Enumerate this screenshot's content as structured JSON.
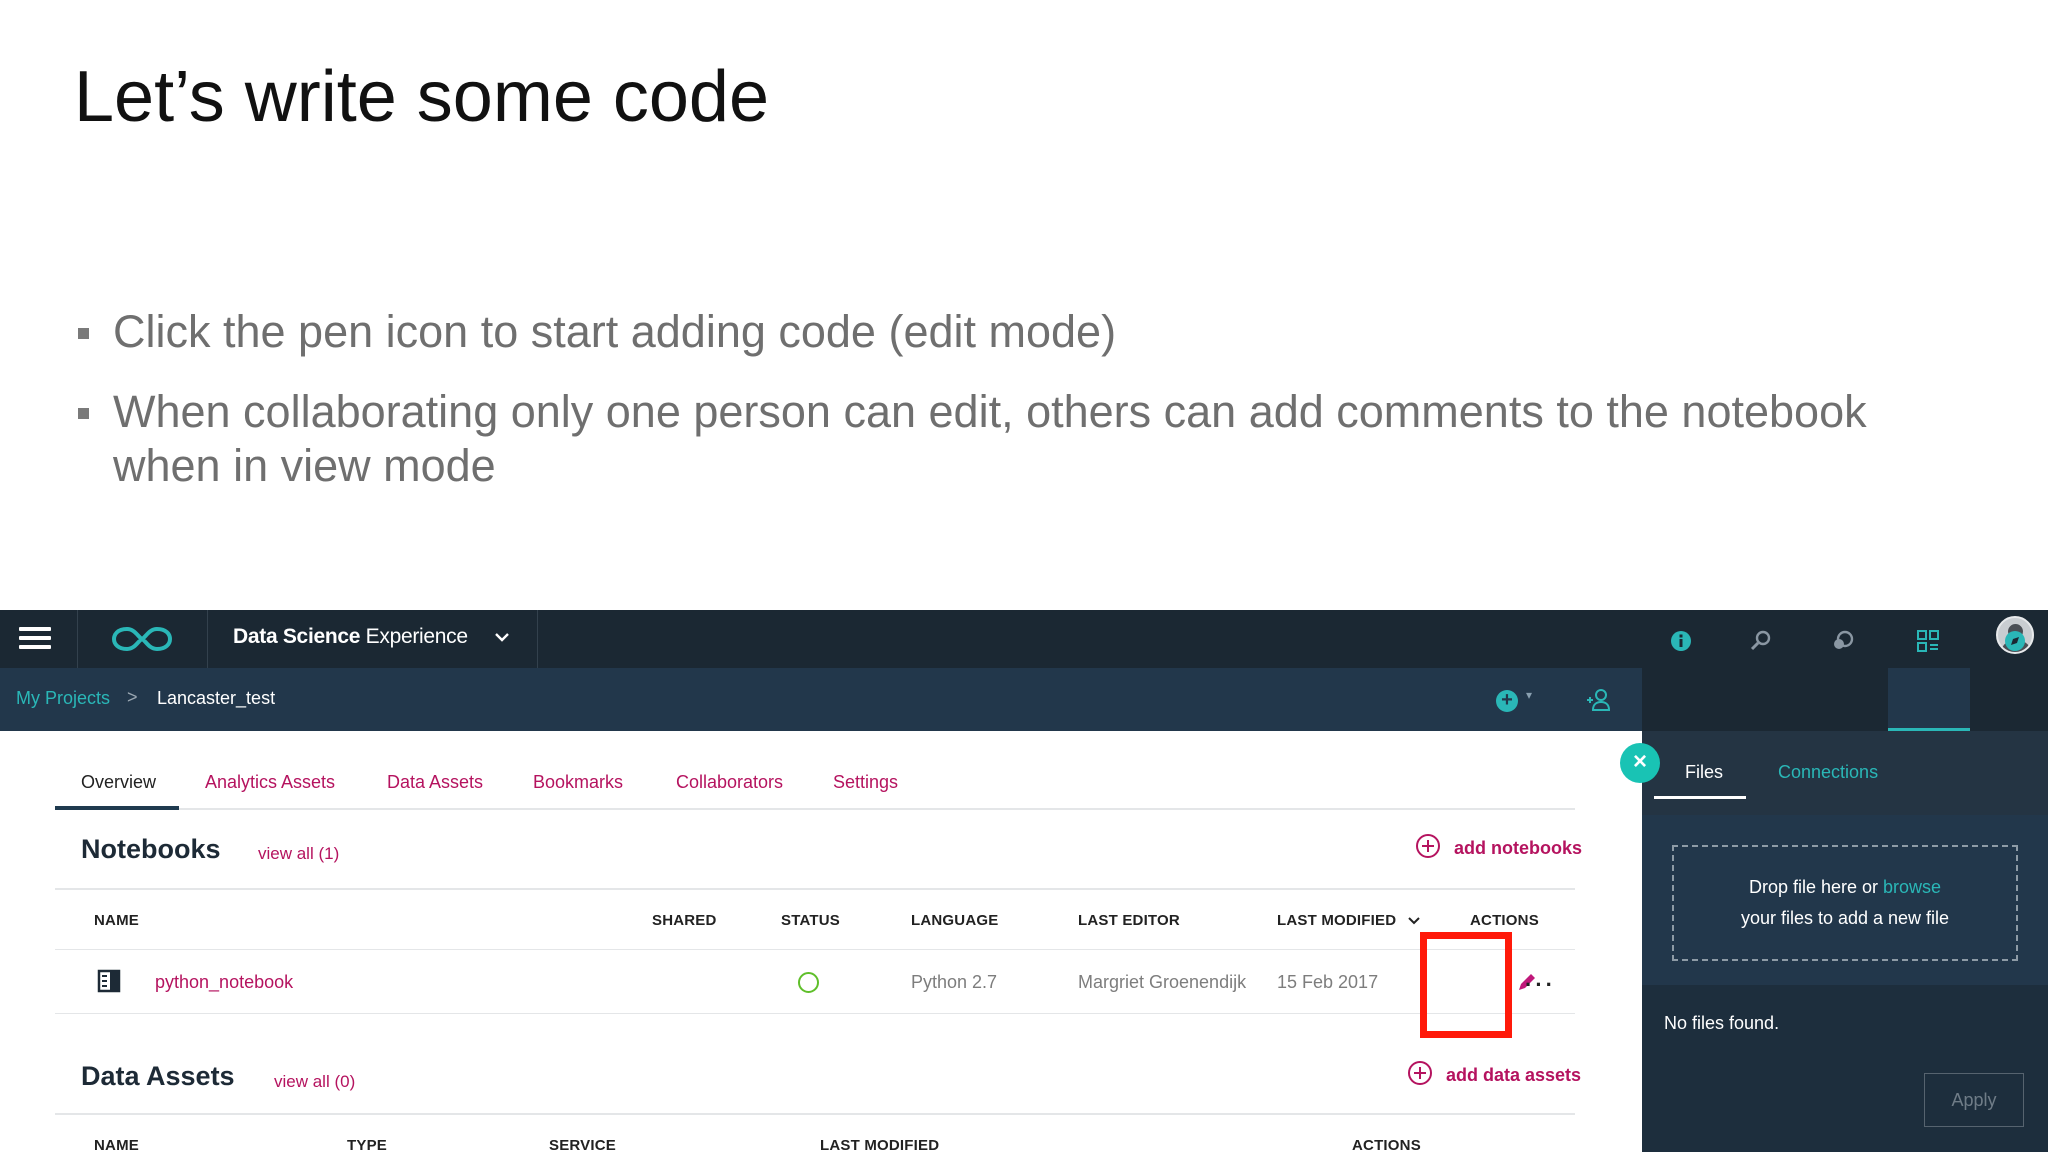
{
  "slide": {
    "title": "Let’s write some code",
    "bullets": [
      "Click the pen icon to start adding code (edit mode)",
      "When collaborating only one person can edit, others can add comments to the notebook when in view mode"
    ]
  },
  "topbar": {
    "product_bold": "Data Science",
    "product_rest": " Experience",
    "icons": [
      "menu-icon",
      "infinity-logo-icon",
      "chevron-down-icon",
      "user-avatar-icon"
    ]
  },
  "breadcrumb": {
    "parent": "My Projects",
    "separator": ">",
    "current": "Lancaster_test",
    "add_symbol": "+",
    "caret": "▾"
  },
  "tabs": [
    "Overview",
    "Analytics Assets",
    "Data Assets",
    "Bookmarks",
    "Collaborators",
    "Settings"
  ],
  "notebooks": {
    "title": "Notebooks",
    "view_all": "view all (1)",
    "add_label": "add notebooks",
    "columns": [
      "NAME",
      "SHARED",
      "STATUS",
      "LANGUAGE",
      "LAST EDITOR",
      "LAST MODIFIED",
      "ACTIONS"
    ],
    "rows": [
      {
        "name": "python_notebook",
        "shared": "",
        "status": "active",
        "language": "Python 2.7",
        "last_editor": "Margriet Groenendijk",
        "last_modified": "15 Feb 2017",
        "more": "···"
      }
    ]
  },
  "data_assets": {
    "title": "Data Assets",
    "view_all": "view all (0)",
    "add_label": "add data assets",
    "columns": [
      "NAME",
      "TYPE",
      "SERVICE",
      "LAST MODIFIED",
      "ACTIONS"
    ]
  },
  "panel": {
    "close": "×",
    "tabs": [
      "Files",
      "Connections"
    ],
    "drop_text_1": "Drop file here or ",
    "drop_link": "browse",
    "drop_text_2": "your files to add a new file",
    "empty_text": "No files found.",
    "apply": "Apply"
  },
  "colors": {
    "topbar": "#1b2833",
    "subbar": "#22374b",
    "accent_teal": "#2ab7b7",
    "link_magenta": "#b5135f",
    "highlight_red": "#ff1a0a",
    "status_green": "#5fbf2a"
  }
}
